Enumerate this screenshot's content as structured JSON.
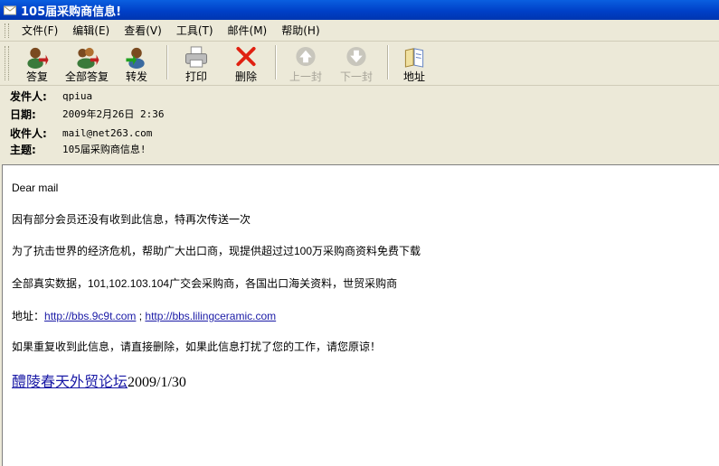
{
  "window": {
    "title": "105届采购商信息!"
  },
  "menu": {
    "items": [
      "文件(F)",
      "编辑(E)",
      "查看(V)",
      "工具(T)",
      "邮件(M)",
      "帮助(H)"
    ]
  },
  "toolbar": {
    "reply": "答复",
    "reply_all": "全部答复",
    "forward": "转发",
    "print": "打印",
    "delete": "删除",
    "previous": "上一封",
    "next": "下一封",
    "addresses": "地址"
  },
  "headers": {
    "from_label": "发件人:",
    "from": "qpiua",
    "date_label": "日期:",
    "date": "2009年2月26日 2:36",
    "to_label": "收件人:",
    "to": "mail@net263.com",
    "subject_label": "主题:",
    "subject": "105届采购商信息!"
  },
  "message": {
    "greeting": "Dear mail",
    "p1": "因有部分会员还没有收到此信息，特再次传送一次",
    "p2": "为了抗击世界的经济危机，帮助广大出口商，现提供超过过100万采购商资料免费下载",
    "p3": "全部真实数据，101,102.103.104广交会采购商，各国出口海关资料，世贸采购商",
    "address_label": "地址：",
    "link1": "http://bbs.9c9t.com",
    "link_sep": " ; ",
    "link2": "http://bbs.lilingceramic.com",
    "p5": "如果重复收到此信息，请直接删除，如果此信息打扰了您的工作，请您原谅！",
    "sig_link": "醴陵春天外贸论坛",
    "sig_date": "2009/1/30"
  }
}
